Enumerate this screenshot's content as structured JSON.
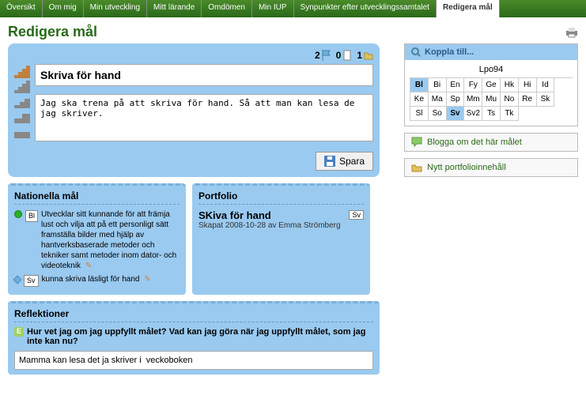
{
  "tabs": [
    "Översikt",
    "Om mig",
    "Min utveckling",
    "Mitt lärande",
    "Omdömen",
    "Min IUP",
    "Synpunkter efter utvecklingssamtalet",
    "Redigera mål"
  ],
  "active_tab": 7,
  "page_title": "Redigera mål",
  "counters": {
    "flags": "2",
    "docs": "0",
    "folders": "1"
  },
  "goal": {
    "title": "Skriva för hand",
    "description": "Jag ska trena på att skriva för hand. Så att man kan lesa de jag skriver."
  },
  "save_label": "Spara",
  "national": {
    "title": "Nationella mål",
    "items": [
      {
        "dot": "green",
        "subj": "Bl",
        "text": "Utvecklar sitt kunnande för att främja lust och vilja att på ett personligt sätt framställa bilder med hjälp av hantverksbaserade metoder och tekniker samt metoder inom dator- och videoteknik"
      },
      {
        "dot": "blue",
        "subj": "Sv",
        "text": "kunna skriva läsligt för hand"
      }
    ]
  },
  "portfolio": {
    "title": "Portfolio",
    "item_title": "SKiva för hand",
    "item_subj": "Sv",
    "meta": "Skapat 2008-10-28 av Emma Strömberg"
  },
  "reflections": {
    "title": "Reflektioner",
    "question": "Hur vet jag om jag uppfyllt målet? Vad kan jag göra när jag uppfyllt målet, som jag inte kan nu?",
    "answer": "Mamma kan lesa det ja skriver i  veckoboken"
  },
  "koppla": {
    "header": "Koppla till...",
    "group": "Lpo94",
    "subjects": [
      "Bl",
      "Bi",
      "En",
      "Fy",
      "Ge",
      "Hk",
      "Hi",
      "Id",
      "Ke",
      "Ma",
      "Sp",
      "Mm",
      "Mu",
      "No",
      "Re",
      "Sk",
      "Sl",
      "So",
      "Sv",
      "Sv2",
      "Ts",
      "Tk"
    ],
    "selected": [
      "Bl",
      "Sv"
    ]
  },
  "actions": {
    "blog": "Blogga om det här målet",
    "portfolio": "Nytt portfolioinnehåll"
  }
}
